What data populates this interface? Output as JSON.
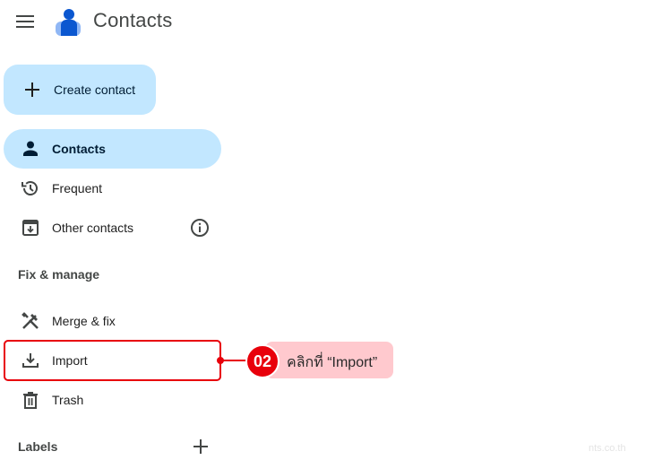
{
  "header": {
    "app_title": "Contacts",
    "menu_icon": "hamburger-menu-icon",
    "logo_icon": "contacts-person-logo",
    "logo_color": "#0b57d0"
  },
  "sidebar": {
    "create_button": {
      "label": "Create contact",
      "icon": "plus-icon"
    },
    "primary_items": [
      {
        "label": "Contacts",
        "icon": "person-icon",
        "active": true
      },
      {
        "label": "Frequent",
        "icon": "history-icon",
        "active": false
      },
      {
        "label": "Other contacts",
        "icon": "archive-download-icon",
        "active": false,
        "trailing_icon": "info-icon"
      }
    ],
    "fix_manage": {
      "title": "Fix & manage",
      "items": [
        {
          "label": "Merge & fix",
          "icon": "tools-icon"
        },
        {
          "label": "Import",
          "icon": "download-icon"
        },
        {
          "label": "Trash",
          "icon": "trash-icon"
        }
      ]
    },
    "labels": {
      "title": "Labels",
      "add_icon": "plus-icon"
    }
  },
  "annotation": {
    "step_number": "02",
    "instruction": "คลิกที่ “Import”",
    "highlight_color": "#e8000b",
    "callout_bg": "#ffc9ce",
    "target": "Import"
  },
  "colors": {
    "active_bg": "#c2e7ff",
    "text_primary": "#1f1f1f",
    "text_secondary": "#444746"
  },
  "watermark": "nts.co.th"
}
